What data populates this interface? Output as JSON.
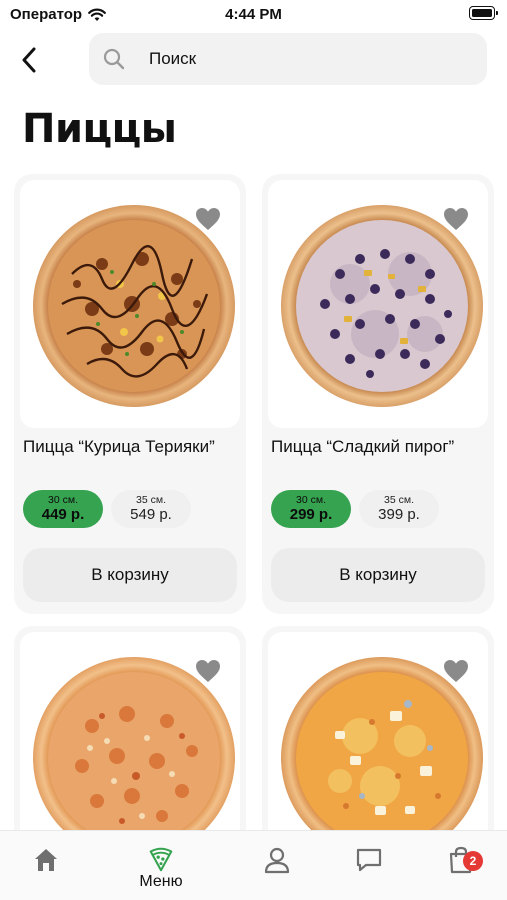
{
  "status_bar": {
    "carrier": "Оператор",
    "time": "4:44 PM"
  },
  "search": {
    "placeholder": "Поиск"
  },
  "page": {
    "title": "Пиццы"
  },
  "products": [
    {
      "name": "Пицца “Курица Терияки”",
      "sizes": [
        {
          "cm": "30 см.",
          "price": "449 р.",
          "selected": true
        },
        {
          "cm": "35 см.",
          "price": "549 р.",
          "selected": false
        }
      ],
      "button": "В корзину"
    },
    {
      "name": "Пицца “Сладкий пирог”",
      "sizes": [
        {
          "cm": "30 см.",
          "price": "299 р.",
          "selected": true
        },
        {
          "cm": "35 см.",
          "price": "399 р.",
          "selected": false
        }
      ],
      "button": "В корзину"
    },
    {
      "name": "",
      "sizes": [],
      "button": ""
    },
    {
      "name": "",
      "sizes": [],
      "button": ""
    }
  ],
  "tabbar": {
    "menu_label": "Меню",
    "cart_badge": "2"
  },
  "colors": {
    "accent": "#35a350",
    "badge": "#e53935",
    "card_bg": "#f6f6f6",
    "button_bg": "#ececec"
  },
  "icons": [
    "wifi-icon",
    "battery-icon",
    "back-chevron-icon",
    "search-icon",
    "heart-icon",
    "home-icon",
    "pizza-slice-icon",
    "profile-icon",
    "chat-icon",
    "shopping-bag-icon"
  ]
}
